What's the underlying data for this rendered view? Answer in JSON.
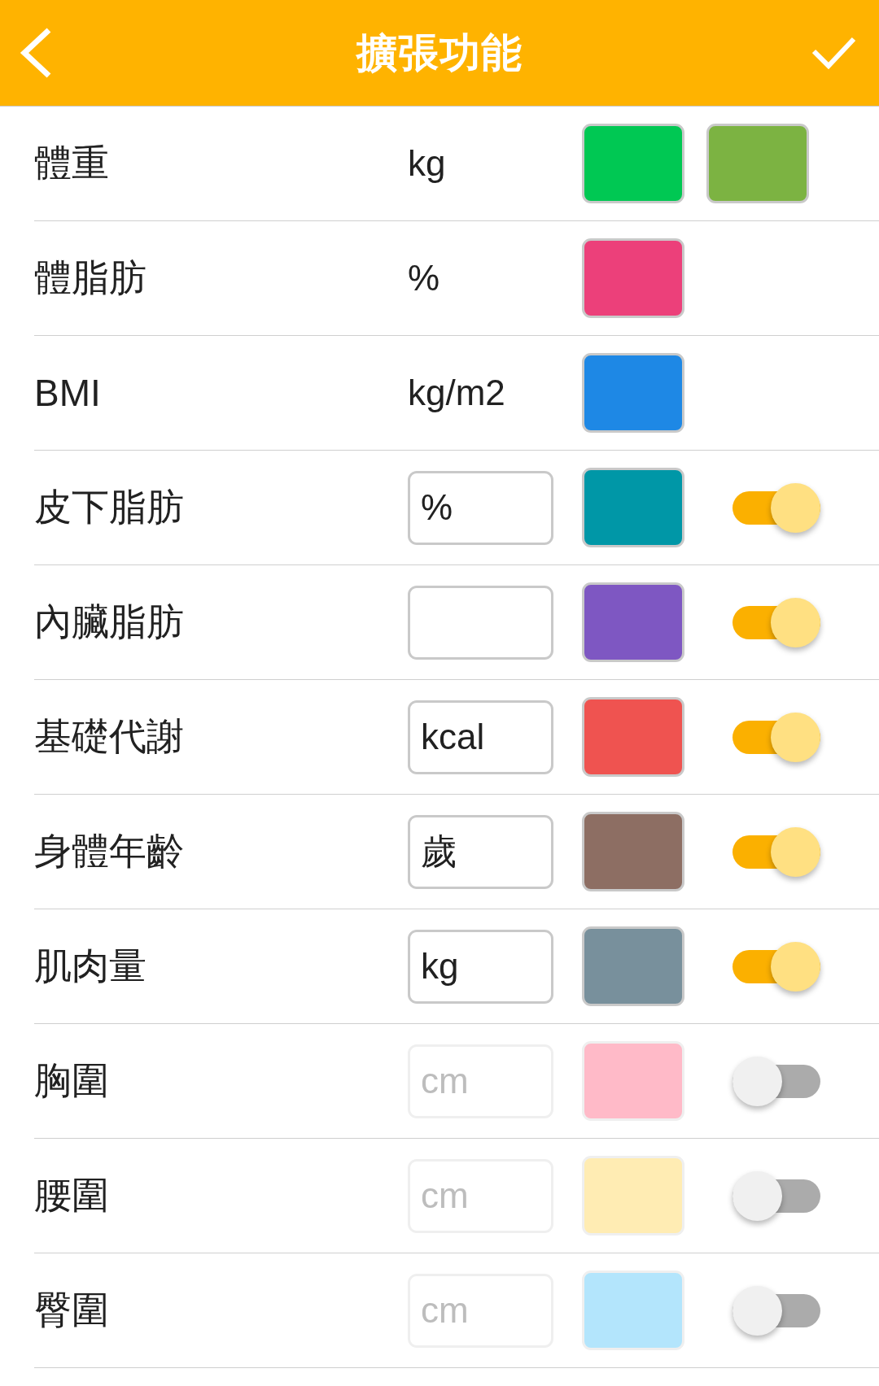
{
  "header": {
    "title": "擴張功能"
  },
  "rows": [
    {
      "kind": "unit",
      "label": "體重",
      "unit": "kg",
      "swatches": [
        {
          "color": "#00c853"
        },
        {
          "color": "#7cb342"
        }
      ]
    },
    {
      "kind": "unit",
      "label": "體脂肪",
      "unit": "%",
      "swatches": [
        {
          "color": "#ec407a"
        }
      ]
    },
    {
      "kind": "unit",
      "label": "BMI",
      "unit": "kg/m2",
      "swatches": [
        {
          "color": "#1e88e5"
        }
      ]
    },
    {
      "kind": "input",
      "label": "皮下脂肪",
      "value": "%",
      "swatches": [
        {
          "color": "#0097a7"
        }
      ],
      "on": true
    },
    {
      "kind": "input",
      "label": "內臟脂肪",
      "swatches": [
        {
          "color": "#7e57c2"
        }
      ],
      "on": true
    },
    {
      "kind": "input",
      "label": "基礎代謝",
      "value": "kcal",
      "swatches": [
        {
          "color": "#ef5350"
        }
      ],
      "on": true
    },
    {
      "kind": "input",
      "label": "身體年齡",
      "value": "歲",
      "swatches": [
        {
          "color": "#8d6e63"
        }
      ],
      "on": true
    },
    {
      "kind": "input",
      "label": "肌肉量",
      "value": "kg",
      "swatches": [
        {
          "color": "#78909c"
        }
      ],
      "on": true
    },
    {
      "kind": "input",
      "label": "胸圍",
      "value": "cm",
      "swatches": [
        {
          "color": "#ffbac8"
        }
      ],
      "on": false
    },
    {
      "kind": "input",
      "label": "腰圍",
      "value": "cm",
      "swatches": [
        {
          "color": "#ffecb3"
        }
      ],
      "on": false
    },
    {
      "kind": "input",
      "label": "臀圍",
      "value": "cm",
      "swatches": [
        {
          "color": "#b3e5fc"
        }
      ],
      "on": false
    }
  ]
}
